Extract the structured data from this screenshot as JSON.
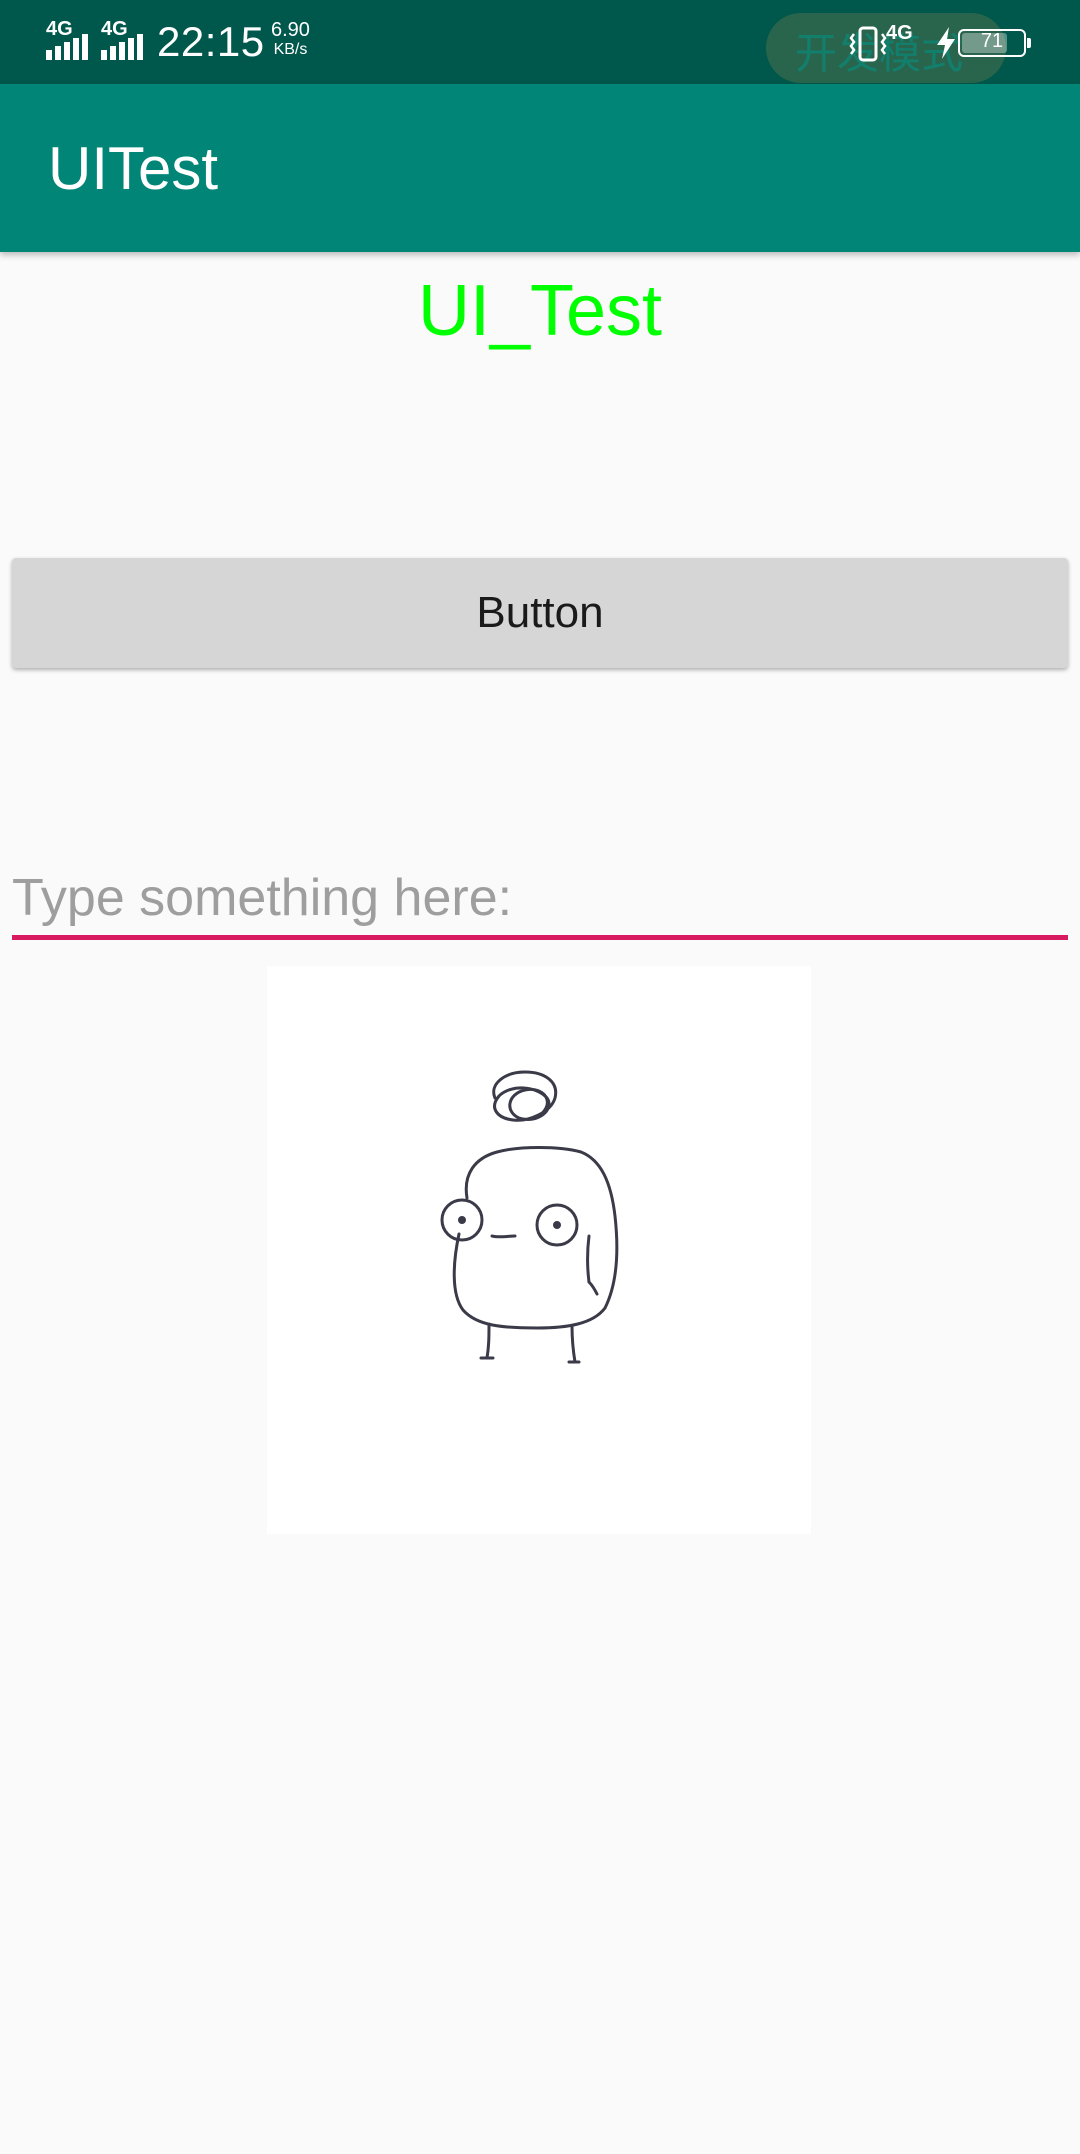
{
  "status_bar": {
    "signal_1": "4G",
    "signal_2": "4G",
    "time": "22:15",
    "net_speed": "6.90",
    "net_speed_unit": "KB/s",
    "overlay_text": "开发模式",
    "network_type": "4G",
    "battery_level": "71",
    "icons": [
      "vibrate-icon",
      "charging-icon",
      "battery-icon"
    ]
  },
  "app_bar": {
    "title": "UITest"
  },
  "main": {
    "heading": "UI_Test",
    "heading_color": "#00ff00",
    "button_label": "Button",
    "input_placeholder": "Type something here:",
    "input_value": "",
    "input_underline_color": "#d81b60",
    "image_description": "doodle-creature"
  },
  "colors": {
    "status_bar": "#00574b",
    "app_bar": "#008577",
    "background": "#fafafa"
  }
}
